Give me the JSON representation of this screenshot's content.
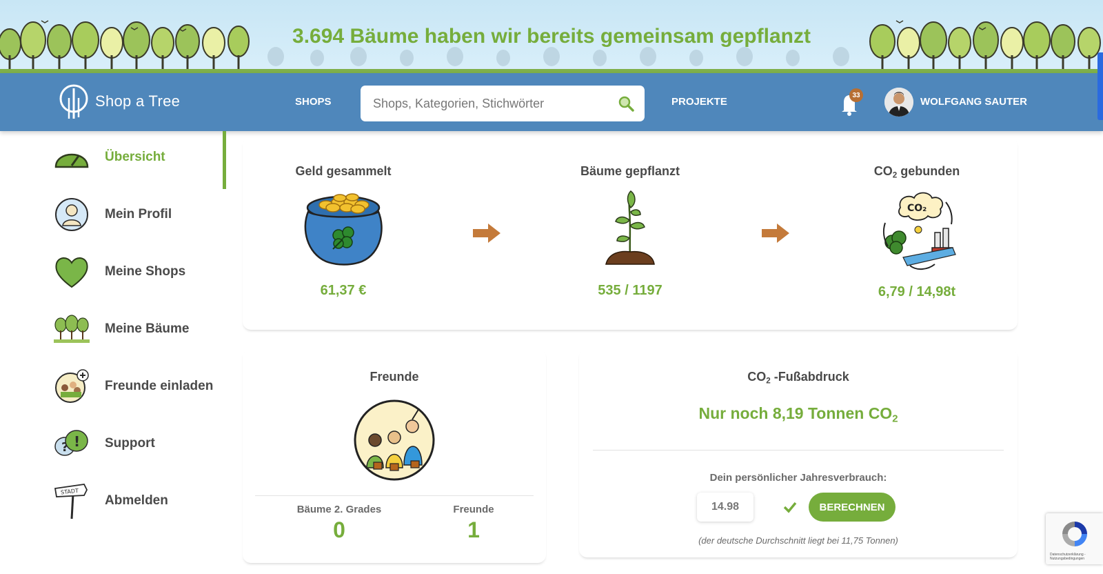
{
  "banner": {
    "headline": "3.694 Bäume haben wir bereits gemeinsam gepflanzt"
  },
  "header": {
    "logo_text": "Shop a Tree",
    "nav_shops": "SHOPS",
    "search_placeholder": "Shops, Kategorien, Stichwörter",
    "nav_projects": "PROJEKTE",
    "notifications_count": "33",
    "user_name": "WOLFGANG SAUTER"
  },
  "sidebar": {
    "items": [
      {
        "label": "Übersicht",
        "icon": "dashboard-gauge-icon",
        "active": true
      },
      {
        "label": "Mein Profil",
        "icon": "profile-icon"
      },
      {
        "label": "Meine Shops",
        "icon": "heart-icon"
      },
      {
        "label": "Meine Bäume",
        "icon": "trees-icon"
      },
      {
        "label": "Freunde einladen",
        "icon": "invite-friends-icon"
      },
      {
        "label": "Support",
        "icon": "support-icon"
      },
      {
        "label": "Abmelden",
        "icon": "signpost-icon"
      }
    ]
  },
  "stats": {
    "money": {
      "title": "Geld gesammelt",
      "value": "61,37 €",
      "icon": "money-pot-icon"
    },
    "trees": {
      "title": "Bäume gepflanzt",
      "value": "535 / 1197",
      "icon": "seedling-icon"
    },
    "co2": {
      "title_prefix": "CO",
      "title_sub": "2",
      "title_suffix": " gebunden",
      "value": "6,79 / 14,98t",
      "icon": "co2-cycle-icon"
    }
  },
  "friends": {
    "title": "Freunde",
    "second_degree_label": "Bäume 2. Grades",
    "second_degree_value": "0",
    "friends_label": "Freunde",
    "friends_value": "1"
  },
  "footprint": {
    "title_prefix": "CO",
    "title_sub": "2",
    "title_suffix": " -Fußabdruck",
    "remaining_prefix": "Nur noch 8,19 Tonnen CO",
    "remaining_sub": "2",
    "annual_label": "Dein persönlicher Jahresverbrauch:",
    "annual_value": "14.98",
    "calc_button": "BERECHNEN",
    "note": "(der deutsche Durchschnitt liegt bei 11,75 Tonnen)"
  },
  "recaptcha": {
    "text": "Datenschutzerklärung - Nutzungsbedingungen"
  },
  "colors": {
    "green": "#76ad3c",
    "nav_blue": "#4f87bb",
    "badge": "#b76f33",
    "arrow": "#c47a3a"
  }
}
